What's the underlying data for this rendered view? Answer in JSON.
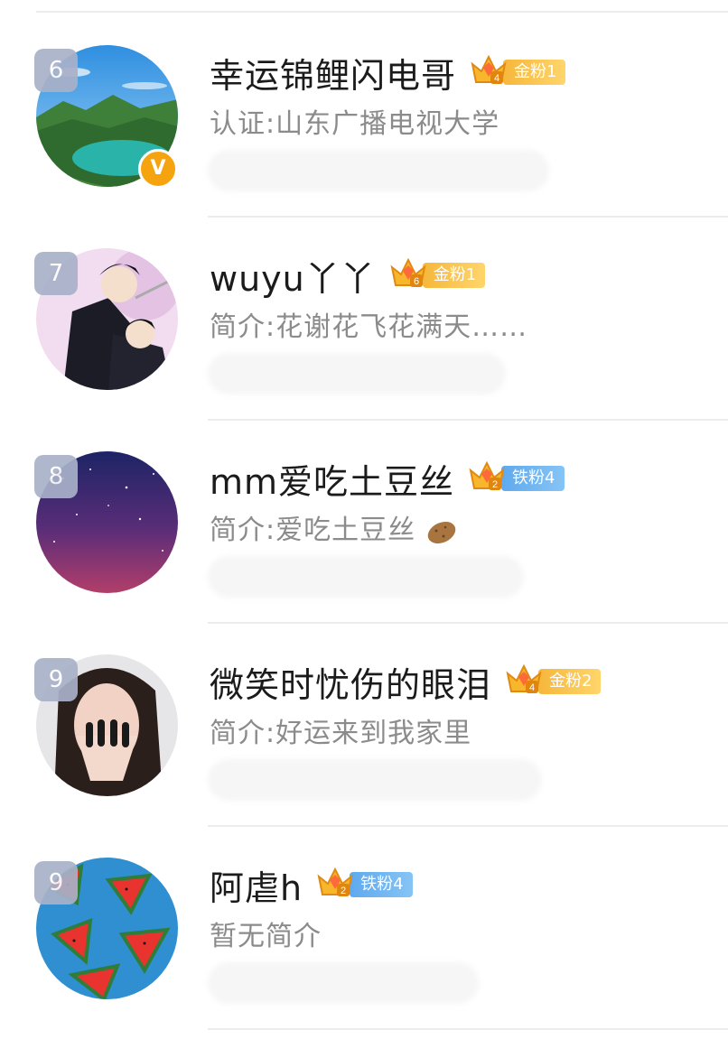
{
  "rows": [
    {
      "rank": "6",
      "name": "幸运锦鲤闪电哥",
      "crown_level": "4",
      "fan_label": "金粉1",
      "fan_type": "gold",
      "intro": "认证:山东广播电视大学",
      "verified": true,
      "verified_mark": "V"
    },
    {
      "rank": "7",
      "name": "wuyu丫丫",
      "crown_level": "6",
      "fan_label": "金粉1",
      "fan_type": "gold",
      "intro": "简介:花谢花飞花满天……"
    },
    {
      "rank": "8",
      "name": "mm爱吃土豆丝",
      "crown_level": "2",
      "fan_label": "铁粉4",
      "fan_type": "iron",
      "intro": "简介:爱吃土豆丝"
    },
    {
      "rank": "9",
      "name": "微笑时忧伤的眼泪",
      "crown_level": "4",
      "fan_label": "金粉2",
      "fan_type": "gold",
      "intro": "简介:好运来到我家里"
    },
    {
      "rank": "9",
      "name": "阿虐h",
      "crown_level": "2",
      "fan_label": "铁粉4",
      "fan_type": "iron",
      "intro": "暂无简介"
    }
  ],
  "icons": {
    "crown": "crown-icon",
    "verified": "verified-v-icon",
    "potato": "potato-emoji-icon"
  },
  "colors": {
    "gold": "#f6b73b",
    "iron": "#5ea9ee",
    "rank_bg": "#a9b1c9",
    "verified": "#f5a40f"
  }
}
